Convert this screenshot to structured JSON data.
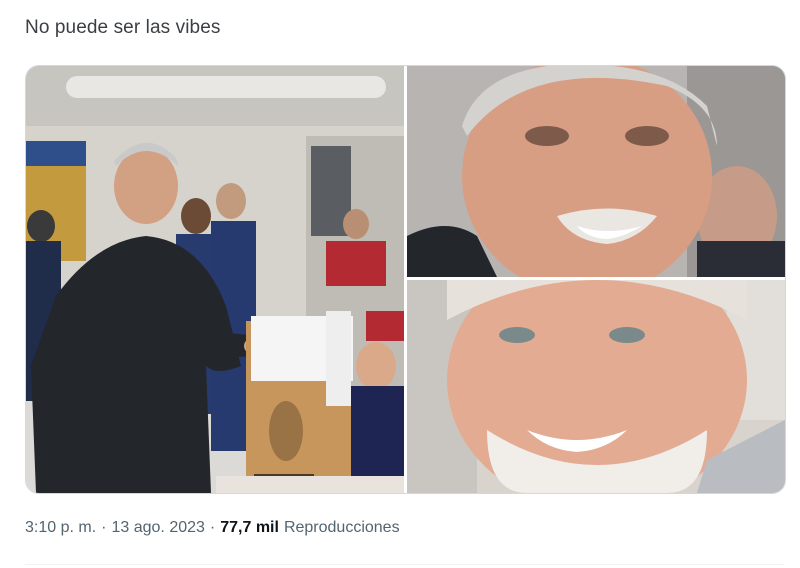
{
  "tweet": {
    "text": "No puede ser las vibes",
    "time": "3:10 p. m.",
    "separator": "·",
    "date": "13 ago. 2023",
    "views_count": "77,7 mil",
    "views_label": "Reproducciones"
  },
  "media": {
    "photo_left": {
      "subject": "man-voting-at-ballot-box"
    },
    "photo_top_right": {
      "subject": "man-face-closeup-smiling"
    },
    "photo_bottom_right": {
      "subject": "older-man-forced-smile"
    }
  },
  "colors": {
    "meta_text": "#536471",
    "border": "#cfd9de"
  }
}
